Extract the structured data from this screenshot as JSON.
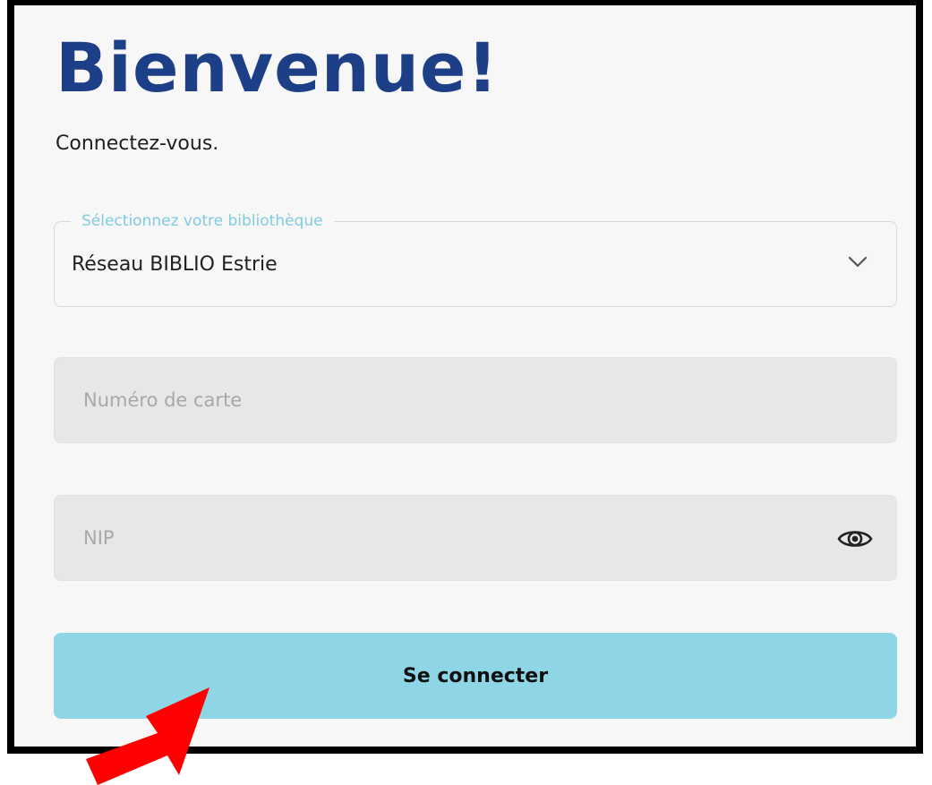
{
  "header": {
    "title": "Bienvenue!",
    "subtitle": "Connectez-vous."
  },
  "library_select": {
    "label": "Sélectionnez votre bibliothèque",
    "value": "Réseau BIBLIO Estrie",
    "icon": "chevron-down-icon"
  },
  "card_number": {
    "placeholder": "Numéro de carte",
    "value": ""
  },
  "pin": {
    "placeholder": "NIP",
    "value": "",
    "toggle_icon": "eye-icon"
  },
  "login_button": {
    "label": "Se connecter",
    "color": "#8ed5e6"
  },
  "annotation": {
    "icon": "red-arrow-icon",
    "color": "#ff0000"
  },
  "colors": {
    "title": "#1c3f87",
    "accent": "#7fcbe0",
    "background": "#f7f7f7",
    "input_background": "#e7e7e7"
  }
}
